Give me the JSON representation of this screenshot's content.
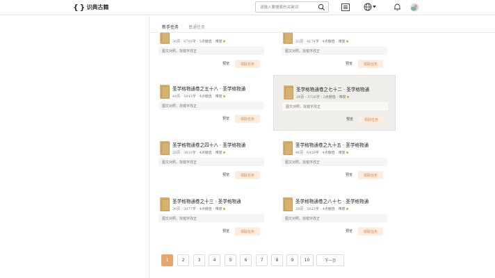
{
  "header": {
    "logo_mark": "{ }",
    "logo_text": "识典古籍",
    "search_placeholder": "请输入要搜索的关键词"
  },
  "tabs": [
    {
      "label": "新手任务",
      "active": true
    },
    {
      "label": "普通任务",
      "active": false
    }
  ],
  "cards": [
    {
      "title": "",
      "meta": "30页 · 6703字 · 5点献值 · 难度",
      "desc": "图文对照，找错字改正",
      "preview": "预览",
      "claim": "领取任务"
    },
    {
      "title": "",
      "meta": "32页 · 4174字 · 4点献值 · 难度",
      "desc": "图文对照，找错字改正",
      "preview": "预览",
      "claim": "领取任务"
    },
    {
      "title": "圣学格物通卷之五十八 · 圣学格物通",
      "meta": "44页 · 5843字 · 4点献值 · 难度",
      "desc": "图文对照，找错字改正",
      "preview": "预览",
      "claim": "领取任务"
    },
    {
      "title": "圣学格物通卷之七十二 · 圣学格物通",
      "meta": "28页 · 3726字 · 2点献值 · 难度",
      "desc": "图文对照，找错字改正",
      "preview": "预览",
      "claim": "领取任务"
    },
    {
      "title": "圣学格物通卷之四十八 · 圣学格物通",
      "meta": "28页 · 3833字 · 4点献值 · 难度",
      "desc": "图文对照，找错字改正",
      "preview": "预览",
      "claim": "领取任务"
    },
    {
      "title": "圣学格物通卷之九十五 · 圣学格物通",
      "meta": "46页 · 6439字 · 4点献值 · 难度",
      "desc": "图文对照，找错字改正",
      "preview": "预览",
      "claim": "领取任务"
    },
    {
      "title": "圣学格物通卷之十三 · 圣学格物通",
      "meta": "30页 · 3877字 · 4点献值 · 难度",
      "desc": "图文对照，找错字改正",
      "preview": "预览",
      "claim": "领取任务"
    },
    {
      "title": "圣学格物通卷之八十七 · 圣学格物通",
      "meta": "28页 · 5023字 · 4点献值 · 难度",
      "desc": "图文对照，找错字改正",
      "preview": "预览",
      "claim": "领取任务"
    }
  ],
  "pagination": {
    "pages": [
      "1",
      "2",
      "3",
      "4",
      "5",
      "6",
      "7",
      "8",
      "9",
      "10"
    ],
    "current": "1",
    "next_label": "下一页"
  },
  "colors": {
    "accent": "#e8a56b",
    "claim_text": "#d9884a",
    "claim_bg": "#fdece0",
    "thumb": "#d6b16f"
  }
}
